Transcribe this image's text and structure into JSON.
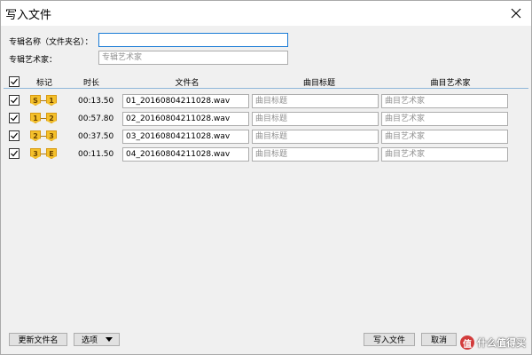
{
  "window": {
    "title": "写入文件",
    "close_icon": "close-icon"
  },
  "album": {
    "name_label": "专辑名称（文件夹名）：",
    "name_value": "",
    "artist_label": "专辑艺术家：",
    "artist_placeholder": "专辑艺术家"
  },
  "table": {
    "columns": {
      "check": "check-icon",
      "marker": "标记",
      "duration": "时长",
      "filename": "文件名",
      "song_title": "曲目标题",
      "song_artist": "曲目艺术家"
    },
    "rows": [
      {
        "checked": true,
        "marker_a": "S",
        "marker_b": "1",
        "duration": "00:13.50",
        "filename": "01_20160804211028.wav",
        "title_placeholder": "曲目标题",
        "artist_placeholder": "曲目艺术家"
      },
      {
        "checked": true,
        "marker_a": "1",
        "marker_b": "2",
        "duration": "00:57.80",
        "filename": "02_20160804211028.wav",
        "title_placeholder": "曲目标题",
        "artist_placeholder": "曲目艺术家"
      },
      {
        "checked": true,
        "marker_a": "2",
        "marker_b": "3",
        "duration": "00:37.50",
        "filename": "03_20160804211028.wav",
        "title_placeholder": "曲目标题",
        "artist_placeholder": "曲目艺术家"
      },
      {
        "checked": true,
        "marker_a": "3",
        "marker_b": "E",
        "duration": "00:11.50",
        "filename": "04_20160804211028.wav",
        "title_placeholder": "曲目标题",
        "artist_placeholder": "曲目艺术家"
      }
    ]
  },
  "footer": {
    "rename_label": "更新文件名",
    "options_label": "选项",
    "write_label": "写入文件",
    "cancel_label": "取消"
  },
  "watermark": {
    "logo": "值",
    "text": "什么值得买"
  },
  "colors": {
    "focus_border": "#1a7bd6",
    "marker_fill": "#f4c02b",
    "header_rule": "#8fb6d9"
  }
}
